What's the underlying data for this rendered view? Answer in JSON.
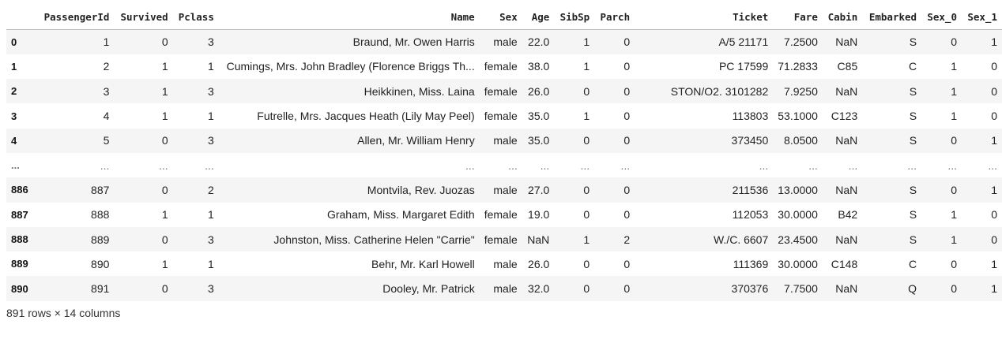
{
  "table": {
    "columns": [
      "",
      "PassengerId",
      "Survived",
      "Pclass",
      "Name",
      "Sex",
      "Age",
      "SibSp",
      "Parch",
      "Ticket",
      "Fare",
      "Cabin",
      "Embarked",
      "Sex_0",
      "Sex_1"
    ],
    "rows": [
      [
        "0",
        "1",
        "0",
        "3",
        "Braund, Mr. Owen Harris",
        "male",
        "22.0",
        "1",
        "0",
        "A/5 21171",
        "7.2500",
        "NaN",
        "S",
        "0",
        "1"
      ],
      [
        "1",
        "2",
        "1",
        "1",
        "Cumings, Mrs. John Bradley (Florence Briggs Th...",
        "female",
        "38.0",
        "1",
        "0",
        "PC 17599",
        "71.2833",
        "C85",
        "C",
        "1",
        "0"
      ],
      [
        "2",
        "3",
        "1",
        "3",
        "Heikkinen, Miss. Laina",
        "female",
        "26.0",
        "0",
        "0",
        "STON/O2. 3101282",
        "7.9250",
        "NaN",
        "S",
        "1",
        "0"
      ],
      [
        "3",
        "4",
        "1",
        "1",
        "Futrelle, Mrs. Jacques Heath (Lily May Peel)",
        "female",
        "35.0",
        "1",
        "0",
        "113803",
        "53.1000",
        "C123",
        "S",
        "1",
        "0"
      ],
      [
        "4",
        "5",
        "0",
        "3",
        "Allen, Mr. William Henry",
        "male",
        "35.0",
        "0",
        "0",
        "373450",
        "8.0500",
        "NaN",
        "S",
        "0",
        "1"
      ],
      [
        "...",
        "...",
        "...",
        "...",
        "...",
        "...",
        "...",
        "...",
        "...",
        "...",
        "...",
        "...",
        "...",
        "...",
        "..."
      ],
      [
        "886",
        "887",
        "0",
        "2",
        "Montvila, Rev. Juozas",
        "male",
        "27.0",
        "0",
        "0",
        "211536",
        "13.0000",
        "NaN",
        "S",
        "0",
        "1"
      ],
      [
        "887",
        "888",
        "1",
        "1",
        "Graham, Miss. Margaret Edith",
        "female",
        "19.0",
        "0",
        "0",
        "112053",
        "30.0000",
        "B42",
        "S",
        "1",
        "0"
      ],
      [
        "888",
        "889",
        "0",
        "3",
        "Johnston, Miss. Catherine Helen \"Carrie\"",
        "female",
        "NaN",
        "1",
        "2",
        "W./C. 6607",
        "23.4500",
        "NaN",
        "S",
        "1",
        "0"
      ],
      [
        "889",
        "890",
        "1",
        "1",
        "Behr, Mr. Karl Howell",
        "male",
        "26.0",
        "0",
        "0",
        "111369",
        "30.0000",
        "C148",
        "C",
        "0",
        "1"
      ],
      [
        "890",
        "891",
        "0",
        "3",
        "Dooley, Mr. Patrick",
        "male",
        "32.0",
        "0",
        "0",
        "370376",
        "7.7500",
        "NaN",
        "Q",
        "0",
        "1"
      ]
    ]
  },
  "footer": {
    "shape_text": "891 rows × 14 columns"
  }
}
